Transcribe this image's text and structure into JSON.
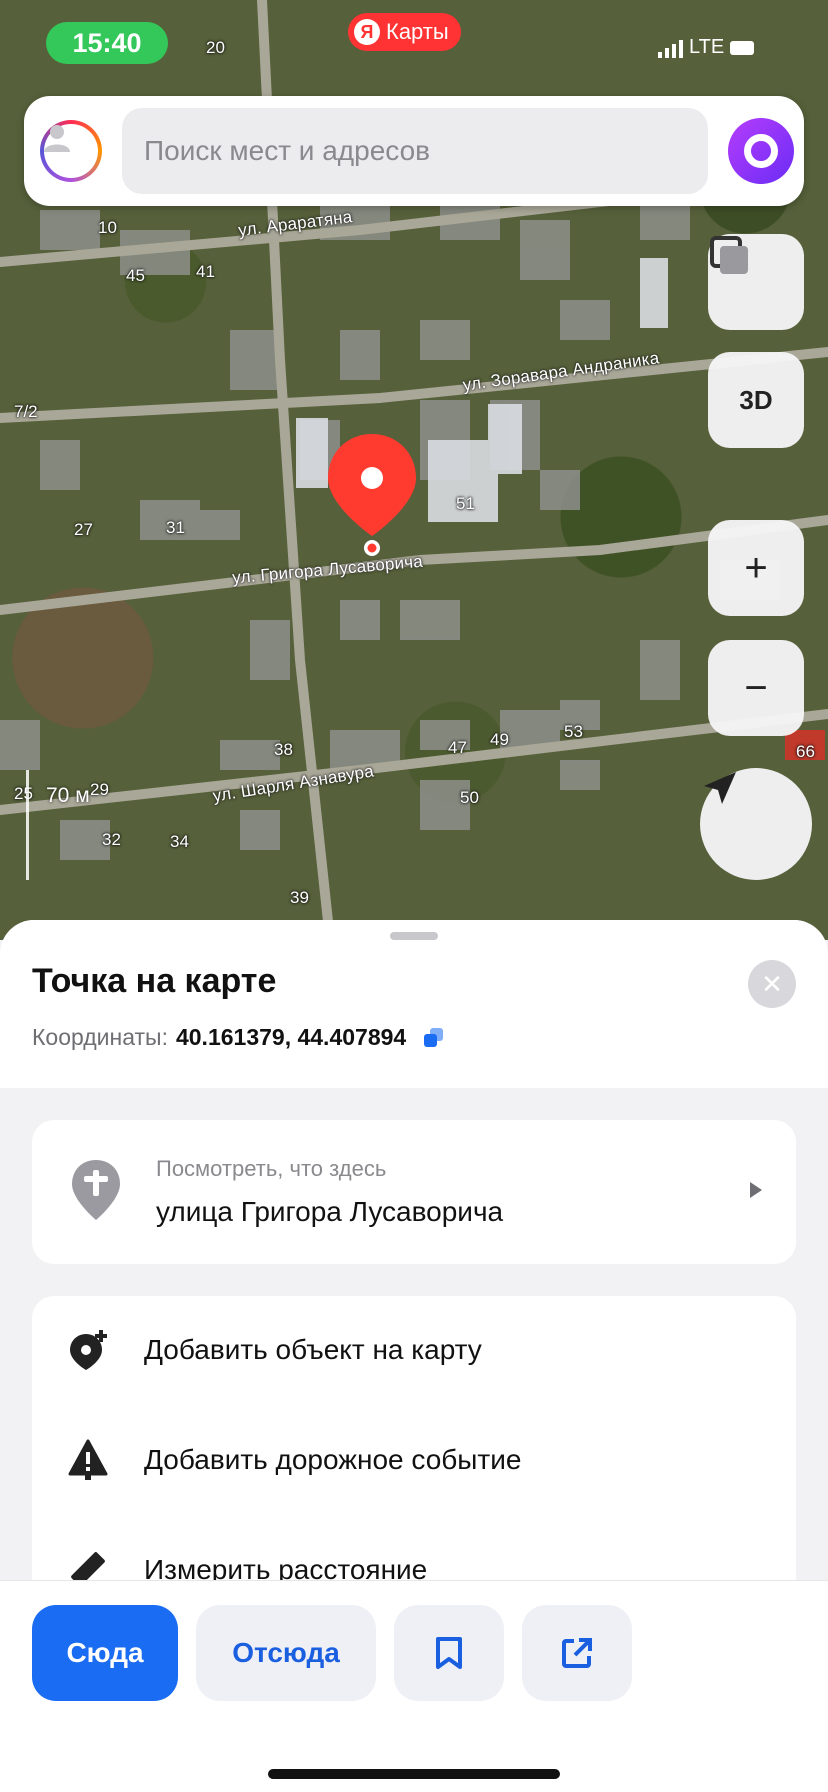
{
  "status_bar": {
    "time": "15:40",
    "app_badge": "Карты",
    "app_badge_logo": "Я",
    "network": "LTE"
  },
  "search": {
    "placeholder": "Поиск мест и адресов"
  },
  "map": {
    "streets": [
      "ул. Араратяна",
      "ул. Зоравара Андраника",
      "ул. Григора Лусаворича",
      "ул. Шарля Азнавура"
    ],
    "house_numbers": [
      "20",
      "10",
      "45",
      "41",
      "7/2",
      "27",
      "31",
      "51",
      "38",
      "47",
      "49",
      "53",
      "50",
      "29",
      "25",
      "32",
      "34",
      "39",
      "66"
    ],
    "scale": "70 м",
    "controls": {
      "layers_icon": "layers-icon",
      "three_d": "3D",
      "zoom_in": "+",
      "zoom_out": "−",
      "location_icon": "navigation-arrow-icon"
    },
    "pin_color": "#ff3b30"
  },
  "sheet": {
    "title": "Точка на карте",
    "coords_label": "Координаты:",
    "coords_value": "40.161379, 44.407894",
    "whats_here": {
      "subtitle": "Посмотреть, что здесь",
      "address": "улица Григора Лусаворича"
    },
    "actions": [
      {
        "label": "Добавить объект на карту",
        "icon": "add-place-icon"
      },
      {
        "label": "Добавить дорожное событие",
        "icon": "road-event-warning-icon"
      },
      {
        "label": "Измерить расстояние",
        "icon": "ruler-icon"
      }
    ]
  },
  "bottom_bar": {
    "to_here": "Сюда",
    "from_here": "Отсюда",
    "bookmark_icon": "bookmark-icon",
    "share_icon": "share-icon"
  },
  "colors": {
    "accent": "#1a6cf2",
    "pin": "#ff3b30",
    "status_pill": "#34c759",
    "brand": "#ff3333"
  }
}
